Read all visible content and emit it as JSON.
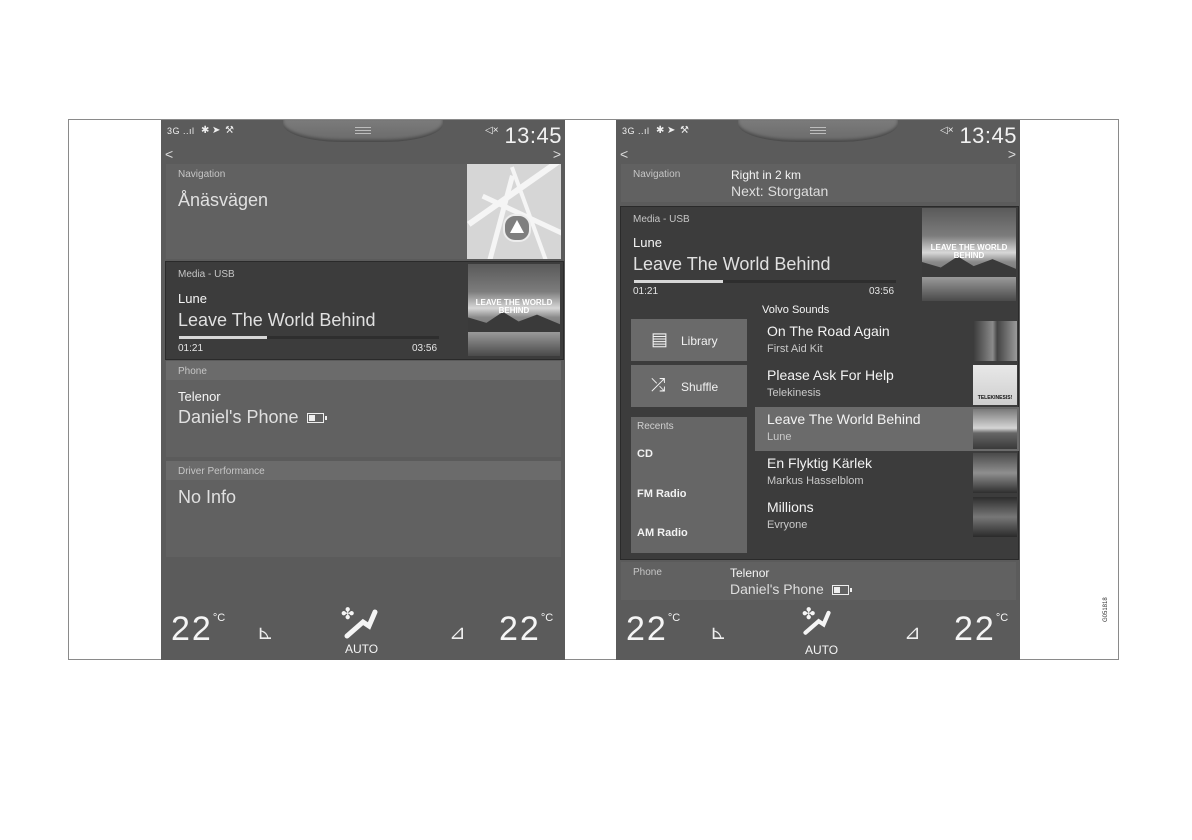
{
  "status_bar": {
    "signal": "3G",
    "clock": "13:45"
  },
  "left_screen": {
    "navigation": {
      "header": "Navigation",
      "street": "Ånäsvägen"
    },
    "media": {
      "header": "Media - USB",
      "artist": "Lune",
      "track": "Leave The World Behind",
      "elapsed": "01:21",
      "duration": "03:56",
      "progress": 0.34,
      "album_title": "LEAVE THE WORLD BEHIND"
    },
    "phone": {
      "header": "Phone",
      "carrier": "Telenor",
      "device": "Daniel's Phone"
    },
    "driver": {
      "header": "Driver Performance",
      "value": "No Info"
    }
  },
  "right_screen": {
    "navigation": {
      "header": "Navigation",
      "instruction": "Right in 2 km",
      "next": "Next: Storgatan"
    },
    "media": {
      "header": "Media - USB",
      "artist": "Lune",
      "track": "Leave The World Behind",
      "elapsed": "01:21",
      "duration": "03:56",
      "progress": 0.34,
      "album_title": "LEAVE THE WORLD BEHIND"
    },
    "source_name": "Volvo Sounds",
    "library_label": "Library",
    "shuffle_label": "Shuffle",
    "recents": {
      "header": "Recents",
      "items": [
        "CD",
        "FM Radio",
        "AM Radio"
      ]
    },
    "tracks": [
      {
        "title": "On The Road Again",
        "artist": "First Aid Kit"
      },
      {
        "title": "Please Ask For Help",
        "artist": "Telekinesis",
        "art_text": "TELEKINESIS!"
      },
      {
        "title": "Leave The World Behind",
        "artist": "Lune",
        "selected": true
      },
      {
        "title": "En Flyktig Kärlek",
        "artist": "Markus Hasselblom"
      },
      {
        "title": "Millions",
        "artist": "Evryone"
      }
    ],
    "phone": {
      "header": "Phone",
      "carrier": "Telenor",
      "device": "Daniel's Phone"
    }
  },
  "climate": {
    "left_temp": "22",
    "right_temp": "22",
    "unit": "°C",
    "mode": "AUTO"
  },
  "figure_id": "G051818"
}
